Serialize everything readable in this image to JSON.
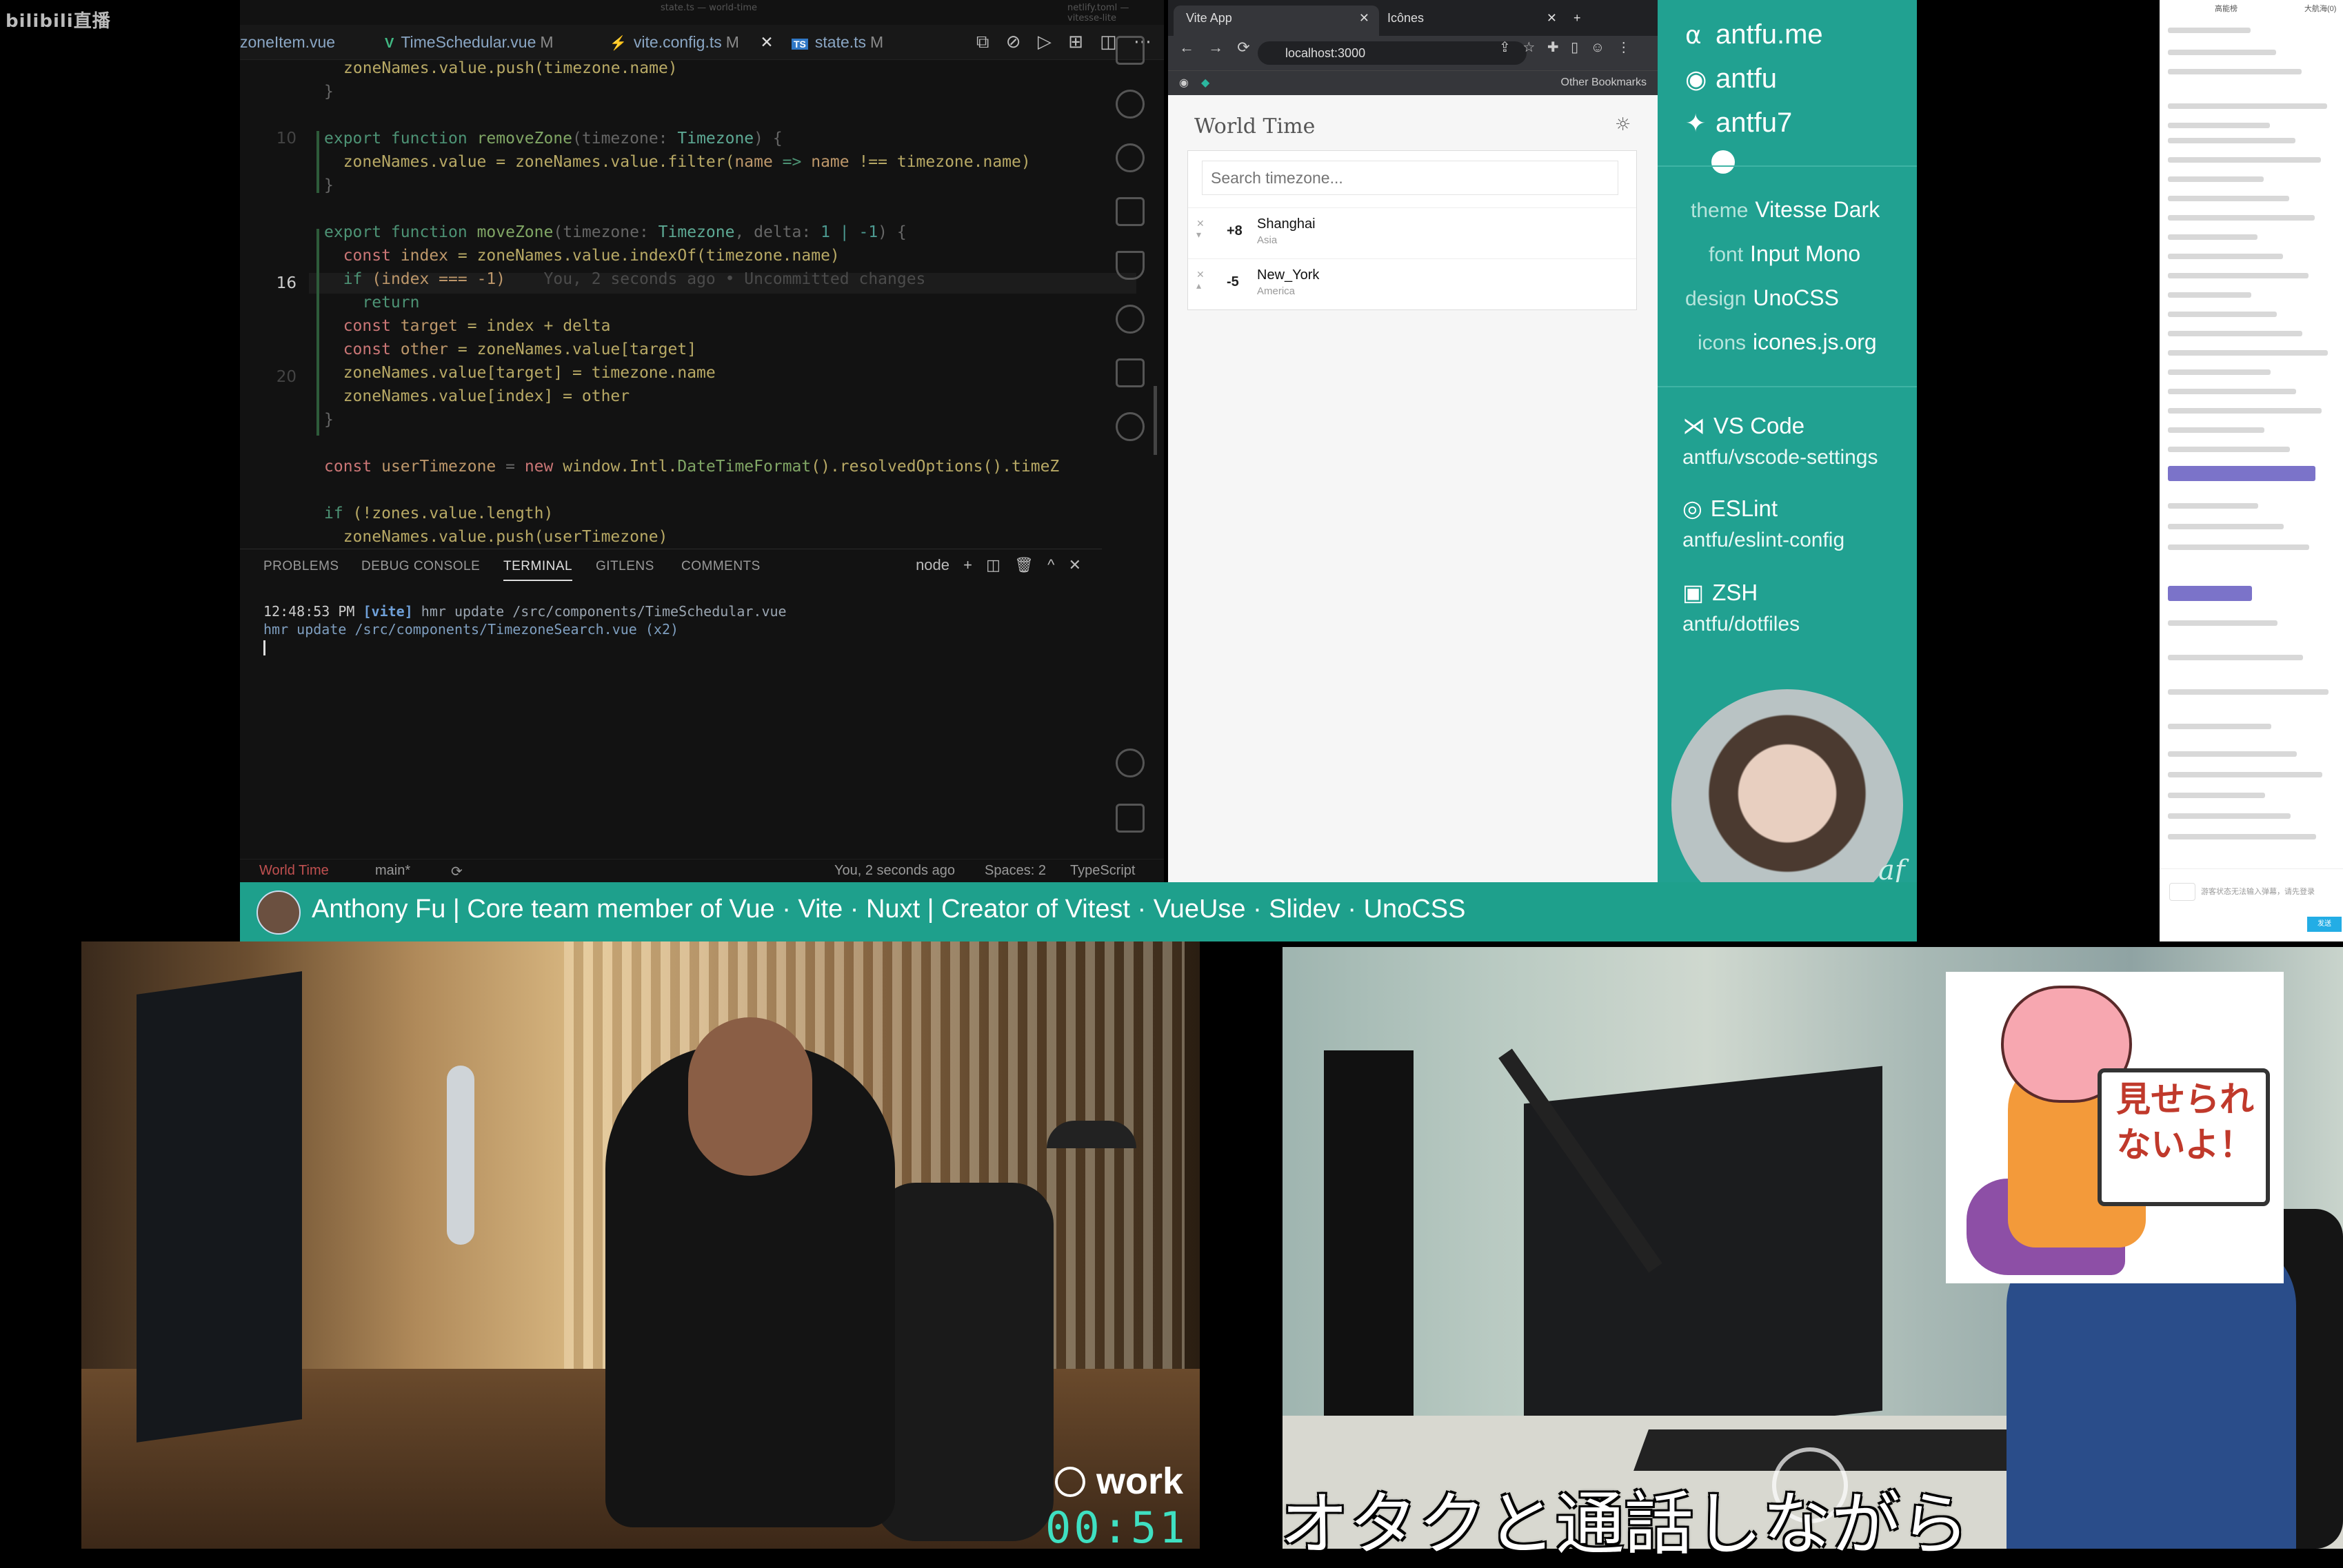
{
  "stream": {
    "logo": "bilibili直播"
  },
  "editor": {
    "top_strip": "state.ts — world-time",
    "top_strip_right": "netlify.toml — vitesse-lite",
    "tabs": [
      {
        "icon": "",
        "label": "zoneItem.vue",
        "mod": ""
      },
      {
        "icon": "V",
        "label": "TimeSchedular.vue",
        "mod": "M"
      },
      {
        "icon": "⚡",
        "label": "vite.config.ts",
        "mod": "M"
      },
      {
        "icon": "TS",
        "label": "state.ts",
        "mod": "M"
      }
    ],
    "tab_close": "✕",
    "toolbar_icons": [
      "⧉",
      "⊘",
      "▷",
      "⊞",
      "◫",
      "⋯"
    ],
    "gutter": {
      "current": "16",
      "twenty": "20",
      "ten": "10"
    },
    "code": {
      "l1": "zoneNames.value.push(timezone.name)",
      "l2": "}",
      "l3a": "export function ",
      "l3b": "removeZone",
      "l3c": "(timezone: ",
      "l3d": "Timezone",
      "l3e": ") {",
      "l4a": "  zoneNames.value = zoneNames.value.filter(",
      "l4b": "name",
      "l4c": " => ",
      "l4d": "name",
      "l4e": " !== timezone.name)",
      "l5": "}",
      "l6a": "export function ",
      "l6b": "moveZone",
      "l6c": "(timezone: ",
      "l6d": "Timezone",
      "l6e": ", delta: ",
      "l6f": "1 | -1",
      "l6g": ") {",
      "l7a": "  const ",
      "l7b": "index",
      "l7c": " = zoneNames.value.indexOf(timezone.name)",
      "l8a": "  if ",
      "l8b": "(index === -1)",
      "l8c": "    You, 2 seconds ago • Uncommitted changes",
      "l9": "    return",
      "l10a": "  const ",
      "l10b": "target",
      "l10c": " = index + delta",
      "l11a": "  const ",
      "l11b": "other",
      "l11c": " = zoneNames.value[target]",
      "l12": "  zoneNames.value[target] = timezone.name",
      "l13": "  zoneNames.value[index] = other",
      "l14": "}",
      "l15a": "const ",
      "l15b": "userTimezone",
      "l15c": " = ",
      "l15d": "new ",
      "l15e": "window.Intl.",
      "l15f": "DateTimeFormat",
      "l15g": "().resolvedOptions().timeZ",
      "l16a": "if ",
      "l16b": "(!zones.value.length)",
      "l17": "  zoneNames.value.push(userTimezone)"
    },
    "panel": {
      "tabs": [
        "PROBLEMS",
        "DEBUG CONSOLE",
        "TERMINAL",
        "GITLENS",
        "COMMENTS"
      ],
      "terminal_name": "node",
      "tools": [
        "+",
        "◫",
        "🗑",
        "^",
        "✕"
      ],
      "line1_time": "12:48:53 PM",
      "line1_tag": "[vite]",
      "line1_rest": " hmr update /src/components/TimeSchedular.vue",
      "line2": "hmr update /src/components/TimezoneSearch.vue (x2)"
    },
    "status": {
      "workspace": "World Time",
      "branch": "main*",
      "sync": "⟳",
      "blame": "You, 2 seconds ago",
      "spaces": "Spaces: 2",
      "lang": "TypeScript"
    }
  },
  "browser": {
    "tabs": [
      {
        "label": "Vite App",
        "close": "✕"
      },
      {
        "label": "Icônes",
        "close": "✕"
      }
    ],
    "new_tab": "+",
    "nav": [
      "←",
      "→",
      "⟳"
    ],
    "url": "localhost:3000",
    "bookmarks": "Other Bookmarks",
    "page": {
      "title": "World Time",
      "search_placeholder": "Search timezone...",
      "zones": [
        {
          "offset": "+8",
          "city": "Shanghai",
          "region": "Asia"
        },
        {
          "offset": "-5",
          "city": "New_York",
          "region": "America"
        }
      ]
    }
  },
  "sidebar": {
    "socials": [
      {
        "icon": "antfu-logo-icon",
        "glyph": "⍺",
        "label": "antfu.me"
      },
      {
        "icon": "github-icon",
        "glyph": "◉",
        "label": "antfu"
      },
      {
        "icon": "twitter-icon",
        "glyph": "✦",
        "label": "antfu7"
      }
    ],
    "config": [
      {
        "key": "theme",
        "value": "Vitesse Dark"
      },
      {
        "key": "font",
        "value": "Input Mono"
      },
      {
        "key": "design",
        "value": "UnoCSS"
      },
      {
        "key": "icons",
        "value": "icones.js.org"
      }
    ],
    "tools": [
      {
        "icon": "vscode-icon",
        "glyph": "⋊",
        "name": "VS Code",
        "repo": "antfu/vscode-settings"
      },
      {
        "icon": "eslint-icon",
        "glyph": "◎",
        "name": "ESLint",
        "repo": "antfu/eslint-config"
      },
      {
        "icon": "terminal-icon",
        "glyph": "▣",
        "name": "ZSH",
        "repo": "antfu/dotfiles"
      }
    ],
    "signature": "af"
  },
  "banner": {
    "text": "Anthony Fu  |  Core team member of Vue · Vite · Nuxt  |  Creator of Vitest · VueUse · Slidev · UnoCSS"
  },
  "chat": {
    "header_left": "高能榜",
    "header_right": "大航海(0)",
    "send_label": "发送",
    "input_placeholder": "游客状态无法输入弹幕，请先登录"
  },
  "overlay": {
    "work_label": "work",
    "timer": "00:51",
    "sticker_text": "見せられないよ！",
    "subtitle": "オタクと通話しながら"
  }
}
